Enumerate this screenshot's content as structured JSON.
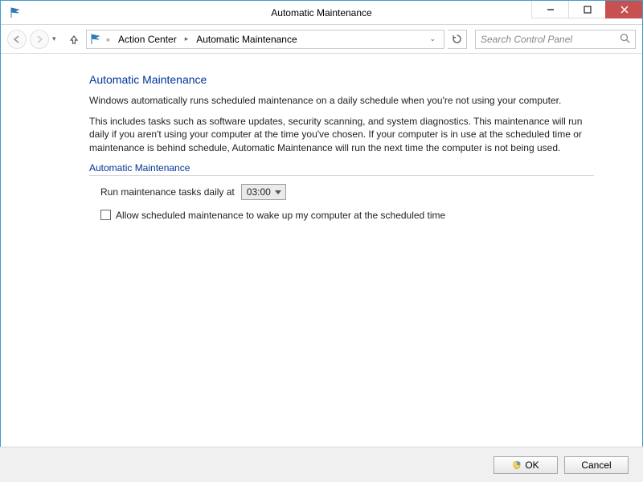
{
  "window": {
    "title": "Automatic Maintenance"
  },
  "breadcrumb": {
    "item1": "Action Center",
    "item2": "Automatic Maintenance"
  },
  "search": {
    "placeholder": "Search Control Panel"
  },
  "main": {
    "heading": "Automatic Maintenance",
    "intro": "Windows automatically runs scheduled maintenance on a daily schedule when you're not using your computer.",
    "details": "This includes tasks such as software updates, security scanning, and system diagnostics. This maintenance will run daily if you aren't using your computer at the time you've chosen. If your computer is in use at the scheduled time or maintenance is behind schedule, Automatic Maintenance will run the next time the computer is not being used.",
    "section_label": "Automatic Maintenance",
    "schedule_label": "Run maintenance tasks daily at",
    "schedule_value": "03:00",
    "wake_label": "Allow scheduled maintenance to wake up my computer at the scheduled time"
  },
  "footer": {
    "ok": "OK",
    "cancel": "Cancel"
  }
}
